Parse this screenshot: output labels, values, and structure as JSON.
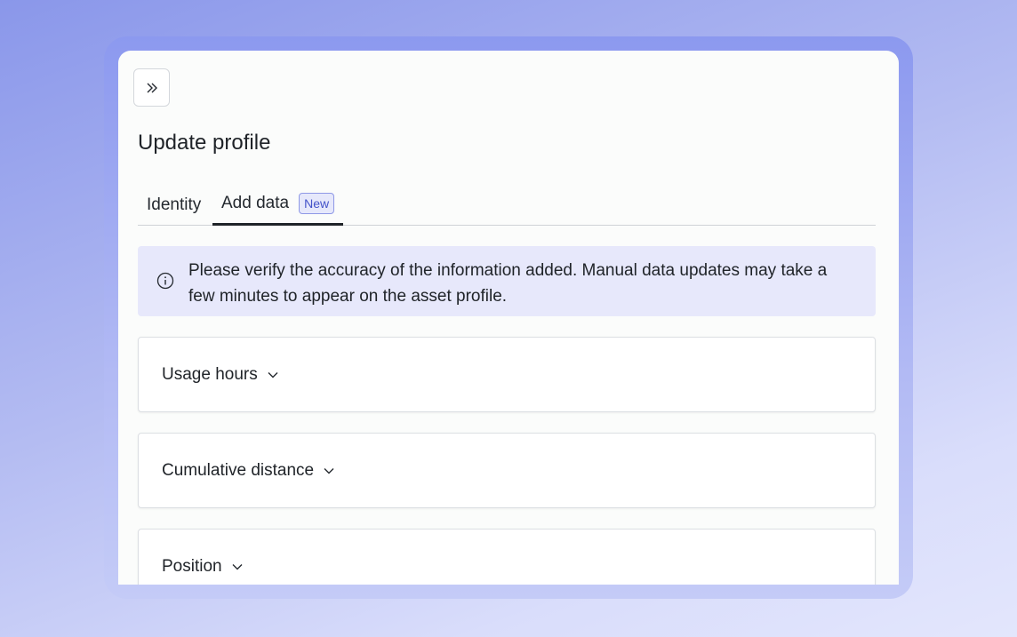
{
  "panel": {
    "expand_icon": "double-chevron-right-icon",
    "title": "Update profile",
    "tabs": [
      {
        "label": "Identity",
        "active": false
      },
      {
        "label": "Add data",
        "active": true,
        "badge": "New"
      }
    ],
    "notice": {
      "icon": "info-icon",
      "text_line1": "Please verify the accuracy of the information added. Manual data updates may take a",
      "text_line2": "few minutes to appear on the asset profile."
    },
    "sections": [
      {
        "label": "Usage hours",
        "icon": "chevron-down-icon"
      },
      {
        "label": "Cumulative distance",
        "icon": "chevron-down-icon"
      },
      {
        "label": "Position",
        "icon": "chevron-down-icon"
      }
    ]
  },
  "colors": {
    "accent": "#4453c9",
    "notice_bg": "#e7e8fb",
    "frame": "#8f9cf0"
  }
}
